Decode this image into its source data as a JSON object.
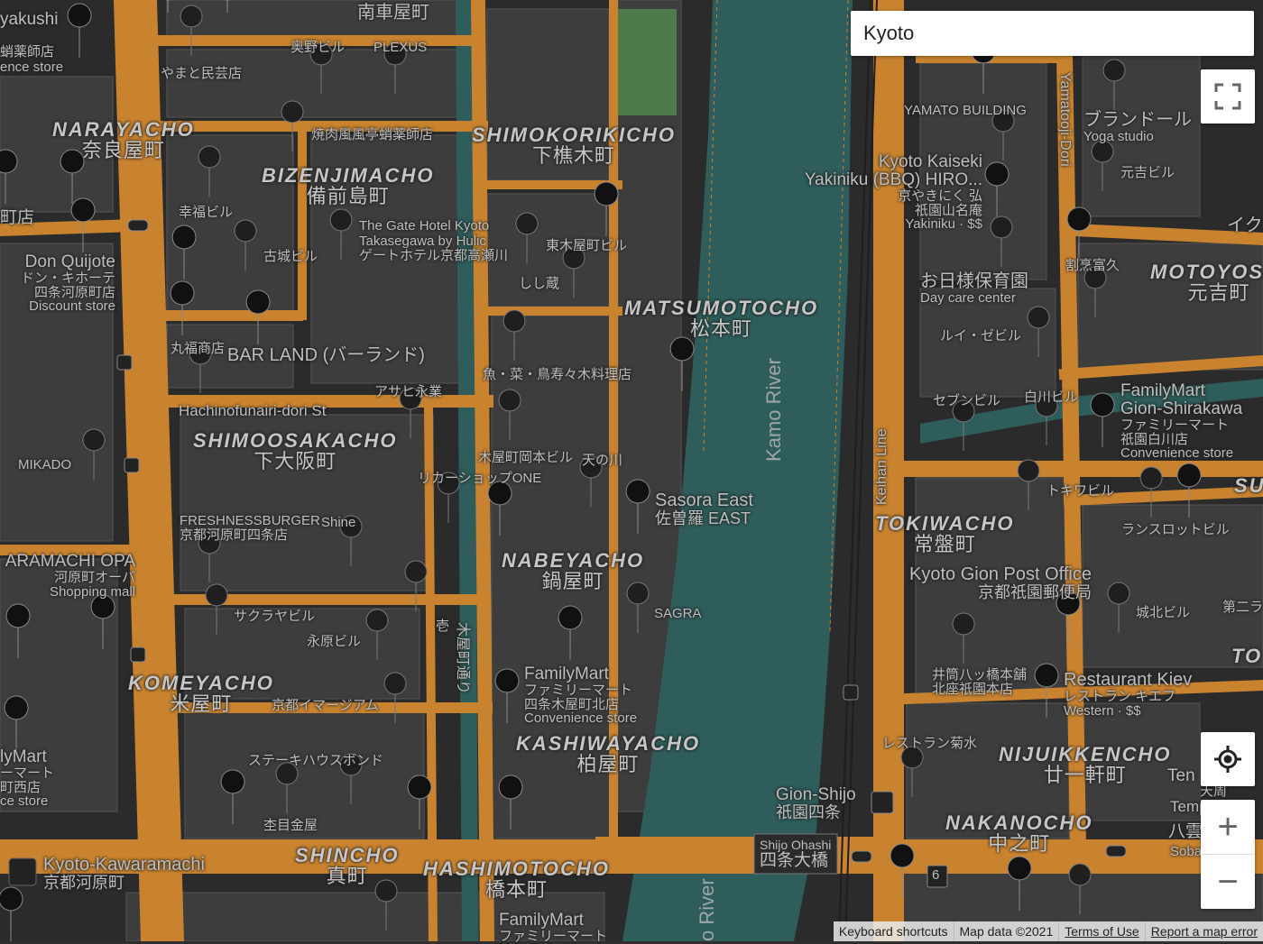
{
  "search": {
    "value": "Kyoto"
  },
  "districts": [
    {
      "en": "NARAYACHO",
      "jp": "奈良屋町"
    },
    {
      "en": "BIZENJIMACHO",
      "jp": "備前島町"
    },
    {
      "en": "SHIMOKORIKICHO",
      "jp": "下樵木町"
    },
    {
      "en": "MATSUMOTOCHO",
      "jp": "松本町"
    },
    {
      "en": "MOTOYOSHI",
      "jp": "元吉町"
    },
    {
      "en": "SHIMOOSAKACHO",
      "jp": "下大阪町"
    },
    {
      "en": "TOKIWACHO",
      "jp": "常盤町"
    },
    {
      "en": "NABEYACHO",
      "jp": "鍋屋町"
    },
    {
      "en": "KOMEYACHO",
      "jp": "米屋町"
    },
    {
      "en": "KASHIWAYACHO",
      "jp": "柏屋町"
    },
    {
      "en": "NIJUIKKENCHO",
      "jp": "廿一軒町"
    },
    {
      "en": "NAKANOCHO",
      "jp": "中之町"
    },
    {
      "en": "SHINCHO",
      "jp": "真町"
    },
    {
      "en": "HASHIMOTOCHO",
      "jp": "橋本町"
    }
  ],
  "places": {
    "minamikuruma": "南車屋町",
    "yakushi": "yakushi",
    "yakuzaishi": "蛸薬師店",
    "convenience_tl": "ence store",
    "yamato": "やまと民芸店",
    "okuno": "奥野ビル",
    "plexus": "PLEXUS",
    "yakinikufu": "焼肉風風亭蛸薬師店",
    "koufuku": "幸福ビル",
    "furuki": "古城ビル",
    "gate_hotel_1": "The Gate Hotel Kyoto",
    "gate_hotel_2": "Takasegawa by Hulic",
    "gate_hotel_3": "ゲートホテル京都高瀬川",
    "higashikiya": "東木屋町ビル",
    "shishizo": "しし蔵",
    "don_quijote_en": "Don Quijote",
    "don_quijote_jp1": "ドン・キホーテ",
    "don_quijote_jp2": "四条河原町店",
    "don_quijote_type": "Discount store",
    "marufuku": "丸福商店",
    "barland": "BAR LAND (バーランド)",
    "asahi": "アサヒ永業",
    "hachinofunairi": "Hachinofunairi-dori St",
    "sakana": "魚・菜・鳥寿々木料理店",
    "mikado": "MIKADO",
    "kiyamachi_okamoto": "木屋町岡本ビル",
    "amanogawa": "天の川",
    "liquor_one": "リカーショップONE",
    "sasora_en": "Sasora East",
    "sasora_jp": "佐曽羅 EAST",
    "freshness_1": "FRESHNESSBURGER",
    "freshness_2": "京都河原町四条店",
    "shine": "Shine",
    "opa_en": "ARAMACHI OPA",
    "opa_jp": "河原町オーパ",
    "opa_type": "Shopping mall",
    "kiyamachi_dori": "木屋町通り",
    "sakuraya": "サクラヤビル",
    "nagahara": "永原ビル",
    "sagra": "SAGRA",
    "kyoto_image": "京都イマージアム",
    "familymart_c_en": "FamilyMart",
    "familymart_c_jp1": "ファミリーマート",
    "familymart_c_jp2": "四条木屋町北店",
    "familymart_c_type": "Convenience store",
    "steak": "ステーキハウスボンド",
    "sugime": "杢目金屋",
    "familymart_l_1": "lyMart",
    "familymart_l_2": "ーマート",
    "familymart_l_3": "町西店",
    "familymart_l_4": "ce store",
    "kawaramachi_en": "Kyoto-Kawaramachi",
    "kawaramachi_jp": "京都河原町",
    "familymart_b_en": "FamilyMart",
    "familymart_b_jp": "ファミリーマート",
    "ki": "壱",
    "yamato_building": "YAMATO BUILDING",
    "brandor_jp": "ブランドール",
    "brandor_type": "Yoga studio",
    "motoyoshi_bldg": "元吉ビル",
    "kaiseki_1": "Kyoto Kaiseki",
    "kaiseki_2": "Yakiniku (BBQ) HIRO...",
    "kaiseki_3": "京やきにく 弘",
    "kaiseki_4": "祇園山名庵",
    "kaiseki_5": "Yakiniku · $$",
    "kappo": "割烹富久",
    "ohisama_jp": "お日様保育園",
    "ohisama_type": "Day care center",
    "louis": "ルイ・ゼビル",
    "seven": "セブンビル",
    "shirakawa": "白川ビル",
    "familymart_r_en": "FamilyMart",
    "familymart_r_2": "Gion-Shirakawa",
    "familymart_r_3": "ファミリーマート",
    "familymart_r_4": "祇園白川店",
    "familymart_r_type": "Convenience store",
    "keihan_line": "Keihan Line",
    "tokiwa_bldg": "トキワビル",
    "lanslot": "ランスロットビル",
    "post_en": "Kyoto Gion Post Office",
    "post_jp": "京都祇園郵便局",
    "jouhoku": "城北ビル",
    "daini": "第二ラ",
    "izutsu_1": "井筒八ッ橋本舗",
    "izutsu_2": "北座祇園本店",
    "kiev_en": "Restaurant Kiev",
    "kiev_jp": "レストラン キエフ",
    "kiev_type": "Western · $$",
    "kikusui": "レストラン菊水",
    "gion_shijo_en": "Gion-Shijo",
    "gion_shijo_jp": "祇園四条",
    "ohashi_en": "Shijo Ohashi",
    "ohashi_jp": "四条大橋",
    "kamo_river": "Kamo River",
    "kamo_river_2": "o River",
    "ten": "Ten",
    "temp": "Temp",
    "tenshu": "天周",
    "hachi": "八雲",
    "soba": "Soba",
    "ik": "イク",
    "su": "SU",
    "to": "TO",
    "edge_l": "町店",
    "route_6": "6"
  },
  "controls": {
    "fullscreen_icon": "fullscreen-icon",
    "location_icon": "my-location-icon",
    "zoom_in": "+",
    "zoom_out": "−"
  },
  "footer": {
    "shortcuts": "Keyboard shortcuts",
    "map_data": "Map data ©2021",
    "terms": "Terms of Use",
    "report": "Report a map error"
  },
  "colors": {
    "road": "#c9832f",
    "block": "#3d3d3d",
    "ground": "#2b2b2b",
    "river": "#2e5d5b",
    "park": "#4f7a4b",
    "label": "#bdbdbd"
  }
}
